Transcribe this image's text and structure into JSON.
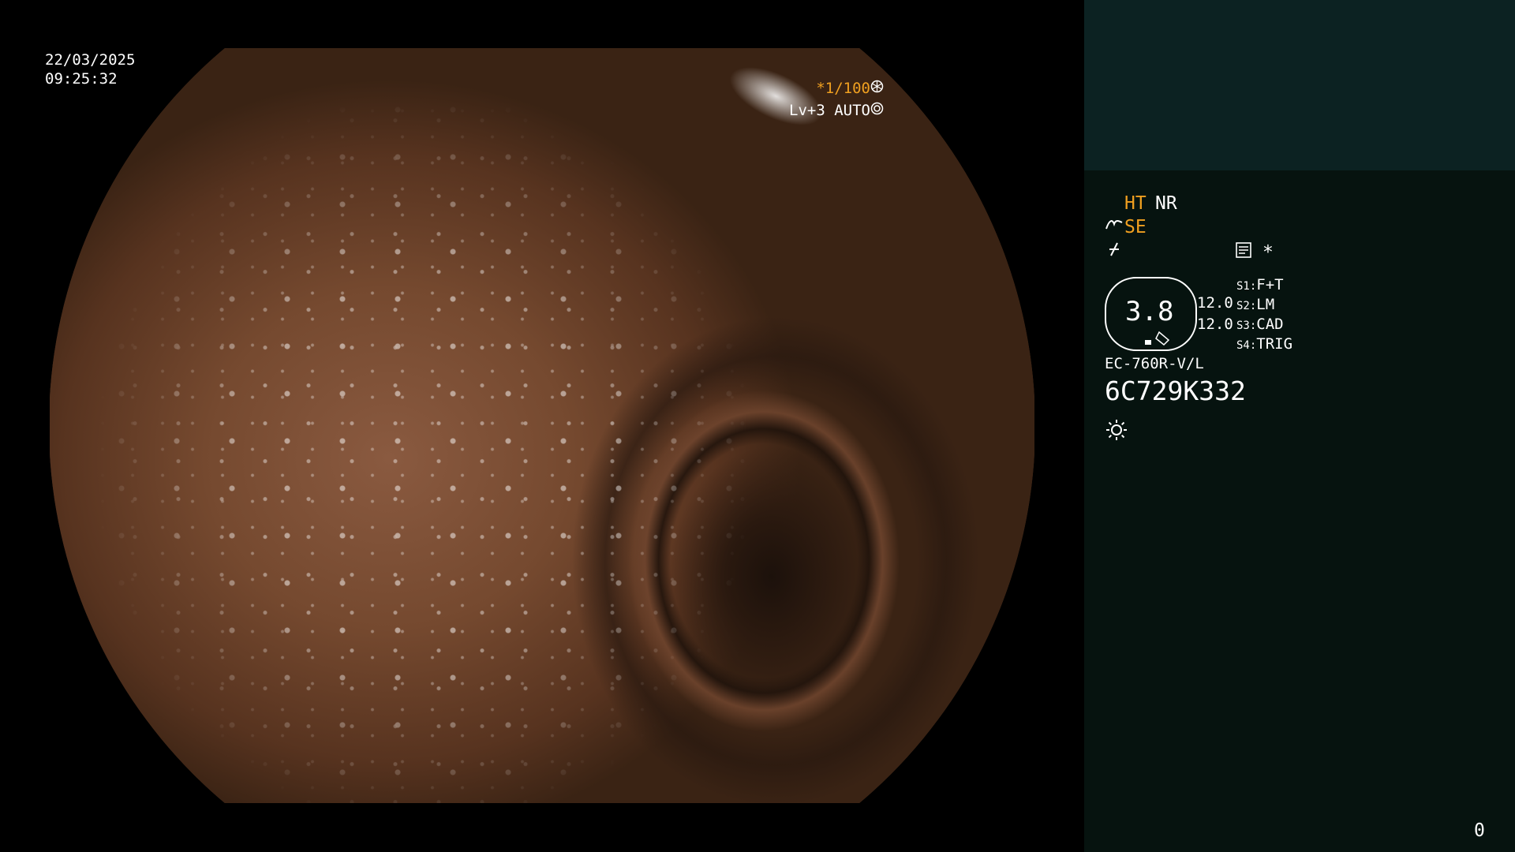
{
  "image": {
    "date": "22/03/2025",
    "time": "09:25:32",
    "shutter": "*1/100",
    "shutter_icon": "aperture-icon",
    "level": "Lv+3 AUTO",
    "level_icon": "iris-icon"
  },
  "panel": {
    "ht_label": "HT",
    "nr_label": "NR",
    "se_label": "SE",
    "mode_icon": "enhancement-icon",
    "freeze_icon": "freeze-icon",
    "memo_icon": "document-icon",
    "star": "*",
    "gauge_value": "3.8",
    "gauge_side_1": "12.0",
    "gauge_side_2": "12.0",
    "switches": [
      {
        "key": "S1:",
        "value": "F+T"
      },
      {
        "key": "S2:",
        "value": "LM"
      },
      {
        "key": "S3:",
        "value": "CAD"
      },
      {
        "key": "S4:",
        "value": "TRIG"
      }
    ],
    "scope_model": "EC-760R-V/L",
    "serial": "6C729K332",
    "light_icon": "sun-icon",
    "counter": "0"
  },
  "colors": {
    "accent": "#f0a020",
    "panel_bg": "#06130f",
    "panel_header_bg": "#0c2222"
  }
}
